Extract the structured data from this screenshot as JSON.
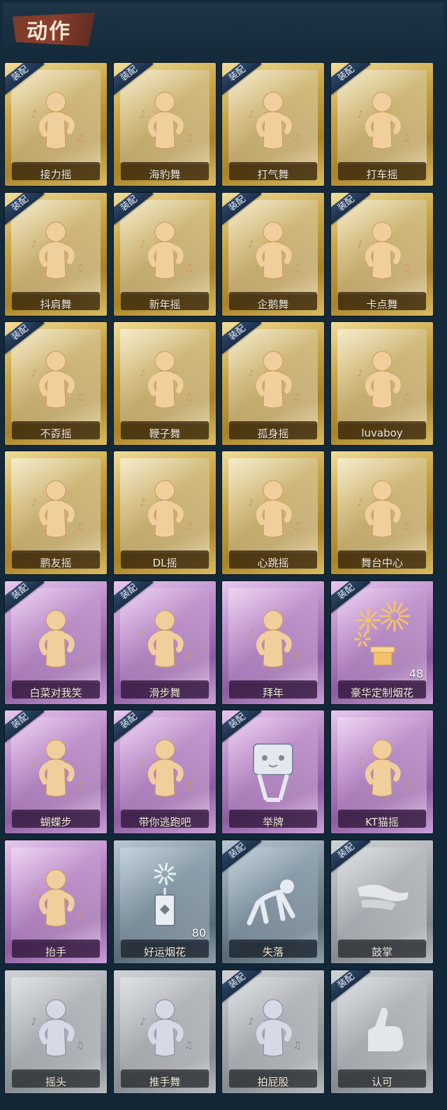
{
  "section_title": "动作",
  "equip_label": "装配",
  "items": [
    {
      "label": "接力摇",
      "tier": "gold",
      "equipped": true,
      "icon": "dance-figure-icon"
    },
    {
      "label": "海豹舞",
      "tier": "gold",
      "equipped": true,
      "icon": "dance-figure-icon"
    },
    {
      "label": "打气舞",
      "tier": "gold",
      "equipped": true,
      "icon": "dance-figure-icon"
    },
    {
      "label": "打车摇",
      "tier": "gold",
      "equipped": true,
      "icon": "dance-figure-icon"
    },
    {
      "label": "抖肩舞",
      "tier": "gold",
      "equipped": true,
      "icon": "dance-figure-icon"
    },
    {
      "label": "新年摇",
      "tier": "gold",
      "equipped": true,
      "icon": "dance-figure-icon"
    },
    {
      "label": "企鹅舞",
      "tier": "gold",
      "equipped": true,
      "icon": "dance-figure-icon"
    },
    {
      "label": "卡点舞",
      "tier": "gold",
      "equipped": true,
      "icon": "dance-figure-icon"
    },
    {
      "label": "不孬摇",
      "tier": "gold",
      "equipped": true,
      "icon": "dance-figure-icon"
    },
    {
      "label": "鞭子舞",
      "tier": "gold",
      "equipped": false,
      "icon": "dance-figure-icon"
    },
    {
      "label": "孤身摇",
      "tier": "gold",
      "equipped": true,
      "icon": "dance-figure-icon"
    },
    {
      "label": "luvaboy",
      "tier": "gold",
      "equipped": false,
      "icon": "dance-figure-icon"
    },
    {
      "label": "鹏友摇",
      "tier": "gold",
      "equipped": false,
      "icon": "dance-figure-icon"
    },
    {
      "label": "DL摇",
      "tier": "gold",
      "equipped": false,
      "icon": "dance-figure-icon"
    },
    {
      "label": "心跳摇",
      "tier": "gold",
      "equipped": false,
      "icon": "dance-figure-icon"
    },
    {
      "label": "舞台中心",
      "tier": "gold",
      "equipped": false,
      "icon": "dance-figure-icon"
    },
    {
      "label": "白菜对我笑",
      "tier": "purple",
      "equipped": true,
      "icon": "dance-figure-icon"
    },
    {
      "label": "滑步舞",
      "tier": "purple",
      "equipped": true,
      "icon": "dance-figure-icon"
    },
    {
      "label": "拜年",
      "tier": "purple",
      "equipped": false,
      "icon": "dance-figure-icon"
    },
    {
      "label": "豪华定制烟花",
      "tier": "purple",
      "equipped": true,
      "icon": "fireworks-icon",
      "count": "48"
    },
    {
      "label": "蝴蝶步",
      "tier": "purple",
      "equipped": true,
      "icon": "dance-figure-icon"
    },
    {
      "label": "带你逃跑吧",
      "tier": "purple",
      "equipped": true,
      "icon": "dance-figure-icon"
    },
    {
      "label": "举牌",
      "tier": "purple",
      "equipped": true,
      "icon": "sign-holder-icon"
    },
    {
      "label": "KT猫摇",
      "tier": "purple",
      "equipped": false,
      "icon": "dance-figure-icon"
    },
    {
      "label": "抬手",
      "tier": "purple",
      "equipped": false,
      "icon": "dance-figure-icon"
    },
    {
      "label": "好运烟花",
      "tier": "silver",
      "equipped": false,
      "icon": "firework-tube-icon",
      "count": "80"
    },
    {
      "label": "失落",
      "tier": "silver",
      "equipped": true,
      "icon": "crawling-figure-icon"
    },
    {
      "label": "鼓掌",
      "tier": "gray",
      "equipped": true,
      "icon": "clapping-hands-icon"
    },
    {
      "label": "摇头",
      "tier": "gray",
      "equipped": false,
      "icon": "dance-figure-icon"
    },
    {
      "label": "推手舞",
      "tier": "gray",
      "equipped": false,
      "icon": "dance-figure-icon"
    },
    {
      "label": "拍屁股",
      "tier": "gray",
      "equipped": true,
      "icon": "dance-figure-icon"
    },
    {
      "label": "认可",
      "tier": "gray",
      "equipped": true,
      "icon": "thumbs-up-icon"
    }
  ]
}
